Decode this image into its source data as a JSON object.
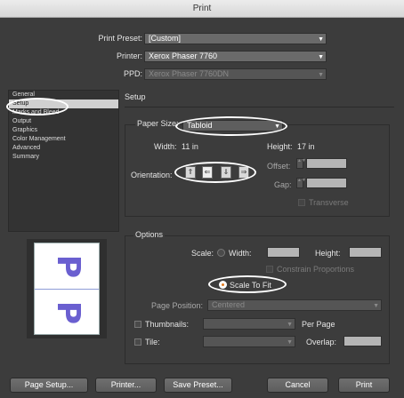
{
  "window": {
    "title": "Print"
  },
  "top": {
    "print_preset_label": "Print Preset:",
    "print_preset_value": "[Custom]",
    "printer_label": "Printer:",
    "printer_value": "Xerox Phaser 7760",
    "ppd_label": "PPD:",
    "ppd_value": "Xerox Phaser 7760DN"
  },
  "sidebar": {
    "items": [
      {
        "label": "General"
      },
      {
        "label": "Setup",
        "active": true
      },
      {
        "label": "Marks and Bleed"
      },
      {
        "label": "Output"
      },
      {
        "label": "Graphics"
      },
      {
        "label": "Color Management"
      },
      {
        "label": "Advanced"
      },
      {
        "label": "Summary"
      }
    ]
  },
  "setup": {
    "heading": "Setup",
    "paper_size_label": "Paper Size:",
    "paper_size_value": "Tabloid",
    "width_label": "Width:",
    "width_value": "11 in",
    "height_label": "Height:",
    "height_value": "17 in",
    "orientation_label": "Orientation:",
    "offset_label": "Offset:",
    "gap_label": "Gap:",
    "transverse_label": "Transverse"
  },
  "options": {
    "heading": "Options",
    "scale_label": "Scale:",
    "width_label": "Width:",
    "height_label": "Height:",
    "constrain_label": "Constrain Proportions",
    "scale_to_fit_label": "Scale To Fit",
    "page_position_label": "Page Position:",
    "page_position_value": "Centered",
    "thumbnails_label": "Thumbnails:",
    "per_page_label": "Per Page",
    "tile_label": "Tile:",
    "overlap_label": "Overlap:"
  },
  "buttons": {
    "page_setup": "Page Setup...",
    "printer": "Printer...",
    "save_preset": "Save Preset...",
    "cancel": "Cancel",
    "print": "Print"
  },
  "colors": {
    "dialog_bg": "#3c3c3c",
    "accent": "#e07a20",
    "preview_glyph": "#6a5fd0"
  }
}
